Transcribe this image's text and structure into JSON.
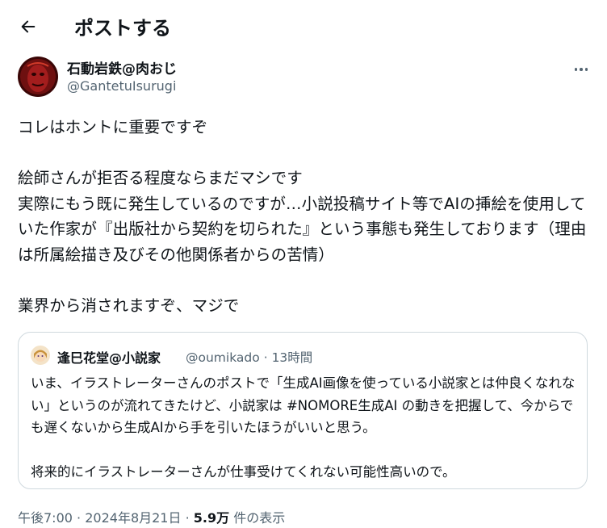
{
  "header": {
    "title": "ポストする"
  },
  "author": {
    "name": "石動岩鉄@肉おじ",
    "handle": "@GantetuIsurugi"
  },
  "tweet": {
    "text": "コレはホントに重要ですぞ\n\n絵師さんが拒否る程度ならまだマシです\n実際にもう既に発生しているのですが…小説投稿サイト等でAIの挿絵を使用していた作家が『出版社から契約を切られた』という事態も発生しております（理由は所属絵描き及びその他関係者からの苦情）\n\n業界から消されますぞ、マジで"
  },
  "quote": {
    "name": "逢巳花堂@小説家",
    "handle": "@oumikado",
    "separator": "·",
    "time": "13時間",
    "text_part1": "いま、イラストレーターさんのポストで「生成AI画像を使っている小説家とは仲良くなれない」というのが流れてきたけど、小説家は ",
    "hashtag": "#NOMORE生成AI",
    "text_part2": " の動きを把握して、今からでも遅くないから生成AIから手を引いたほうがいいと思う。\n\n将来的にイラストレーターさんが仕事受けてくれない可能性高いので。"
  },
  "meta": {
    "time": "午後7:00",
    "dot1": "·",
    "date": "2024年8月21日",
    "dot2": "·",
    "views": "5.9万",
    "views_label": "件の表示"
  },
  "icons": {
    "back": "arrow-left-icon",
    "more": "more-horizontal-icon"
  },
  "colors": {
    "text": "#0f1419",
    "secondary": "#536471",
    "border": "#cfd9de"
  }
}
